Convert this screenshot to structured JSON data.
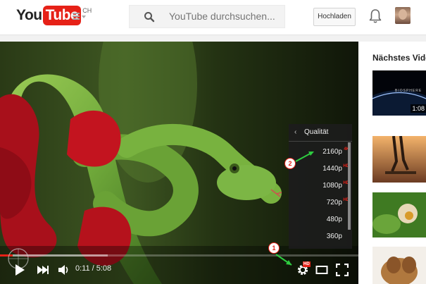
{
  "header": {
    "logo_you": "You",
    "logo_tube": "Tube",
    "logo_region": "CH",
    "search_placeholder": "YouTube durchsuchen...",
    "upload_label": "Hochladen"
  },
  "player": {
    "time_display": "0:11 / 5:08",
    "progress_fraction": 0.036,
    "buffer_fraction": 0.3,
    "quality_menu": {
      "title": "Qualität",
      "options": [
        {
          "label": "2160p",
          "badge": "4K"
        },
        {
          "label": "1440p",
          "badge": "HD"
        },
        {
          "label": "1080p",
          "badge": "HD"
        },
        {
          "label": "720p",
          "badge": "HD"
        },
        {
          "label": "480p",
          "badge": ""
        },
        {
          "label": "360p",
          "badge": ""
        }
      ]
    },
    "settings_badge": "HD"
  },
  "annotations": [
    {
      "number": "1"
    },
    {
      "number": "2"
    }
  ],
  "sidebar": {
    "title": "Nächstes Video",
    "items": [
      {
        "duration": "1:08",
        "overlay_text": "BIOSPHERE"
      },
      {
        "duration": ""
      },
      {
        "duration": ""
      },
      {
        "duration": ""
      }
    ]
  },
  "colors": {
    "brand_red": "#e62117",
    "annotation_arrow": "#2ecc40",
    "page_bg": "#f1f1f1"
  },
  "icons": [
    "menu-icon",
    "search-icon",
    "bell-icon",
    "play-icon",
    "next-icon",
    "volume-icon",
    "gear-icon",
    "theater-mode-icon",
    "fullscreen-icon"
  ]
}
